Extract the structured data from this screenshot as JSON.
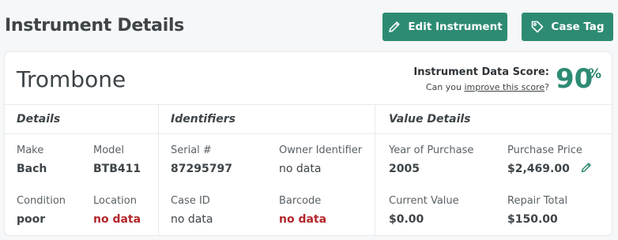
{
  "header": {
    "title": "Instrument Details",
    "edit_button": "Edit Instrument",
    "case_tag_button": "Case Tag"
  },
  "instrument": {
    "name": "Trombone",
    "score_label": "Instrument Data Score:",
    "score_prompt_before": "Can you ",
    "score_link": "improve this score",
    "score_prompt_after": "?",
    "score_value": "90",
    "score_unit": "%"
  },
  "sections": {
    "details": "Details",
    "identifiers": "Identifiers",
    "value_details": "Value Details"
  },
  "fields": {
    "make_label": "Make",
    "make_value": "Bach",
    "model_label": "Model",
    "model_value": "BTB411",
    "condition_label": "Condition",
    "condition_value": "poor",
    "location_label": "Location",
    "location_value": "no data",
    "serial_label": "Serial #",
    "serial_value": "87295797",
    "owner_label": "Owner Identifier",
    "owner_value": "no data",
    "case_label": "Case ID",
    "case_value": "no data",
    "barcode_label": "Barcode",
    "barcode_value": "no data",
    "year_label": "Year of Purchase",
    "year_value": "2005",
    "price_label": "Purchase Price",
    "price_value": "$2,469.00",
    "current_label": "Current Value",
    "current_value": "$0.00",
    "repair_label": "Repair Total",
    "repair_value": "$150.00"
  },
  "colors": {
    "accent": "#2e8b73",
    "alert": "#b3262b"
  },
  "icons": {
    "edit": "pencil-icon",
    "tag": "tag-icon",
    "edit_price": "pencil-icon"
  }
}
